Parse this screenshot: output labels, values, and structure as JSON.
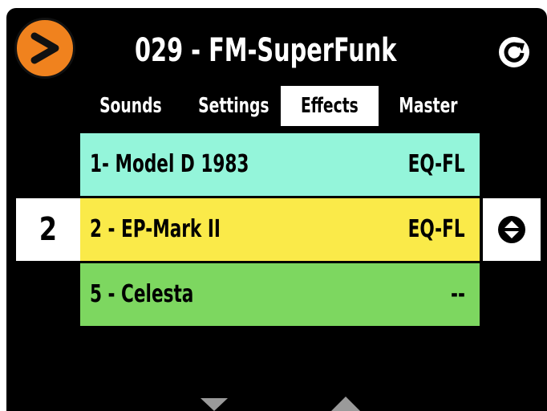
{
  "header": {
    "title": "029 - FM-SuperFunk",
    "menu_icon": "chevron-right-icon",
    "refresh_icon": "refresh-icon"
  },
  "tabs": [
    {
      "label": "Sounds",
      "active": false
    },
    {
      "label": "Settings",
      "active": false
    },
    {
      "label": "Effects",
      "active": true
    },
    {
      "label": "Master",
      "active": false
    }
  ],
  "rows": [
    {
      "name": "1- Model D 1983",
      "effect": "EQ-FL",
      "color": "#94f5da"
    },
    {
      "name": "2 - EP-Mark II",
      "effect": "EQ-FL",
      "color": "#faea49"
    },
    {
      "name": "5 - Celesta",
      "effect": "--",
      "color": "#7dd760"
    }
  ],
  "selected_slot": "2",
  "colors": {
    "accent": "#f0821e",
    "background": "#000000"
  },
  "nav": {
    "down_icon": "triangle-down-icon",
    "up_icon": "triangle-up-icon",
    "updown_icon": "up-down-icon"
  }
}
